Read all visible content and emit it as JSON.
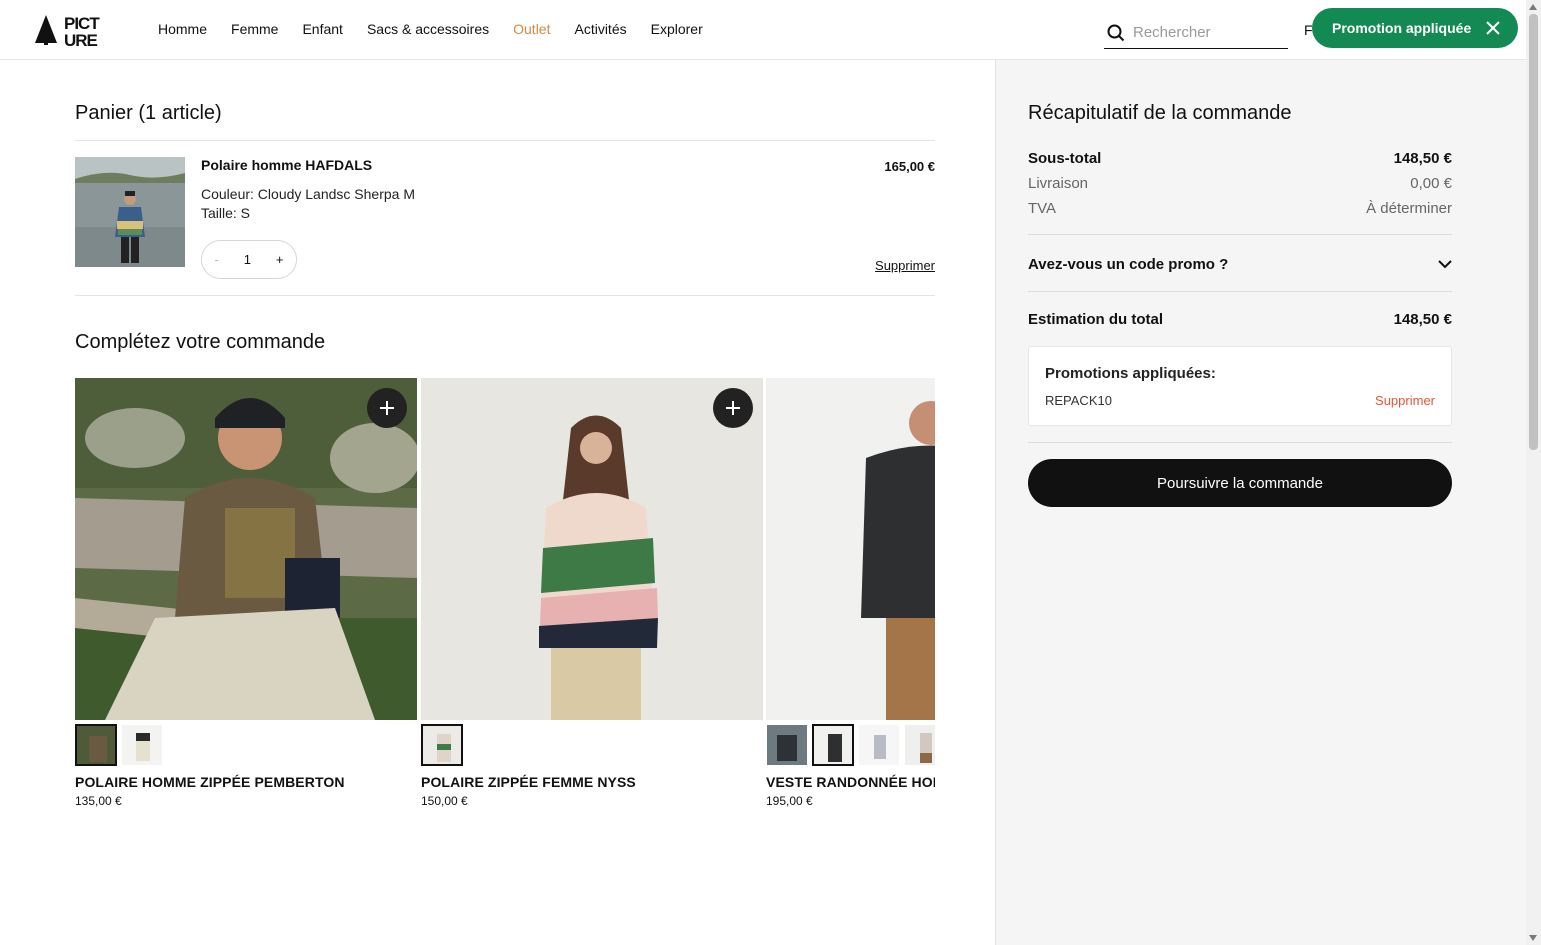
{
  "header": {
    "brand": "PICTURE",
    "nav": [
      "Homme",
      "Femme",
      "Enfant",
      "Sacs & accessoires",
      "Outlet",
      "Activités",
      "Explorer"
    ],
    "search_placeholder": "Rechercher",
    "lang_fragment": "F",
    "promo_toast": "Promotion appliquée"
  },
  "cart": {
    "title": "Panier (1 article)",
    "item": {
      "name": "Polaire homme HAFDALS",
      "price": "165,00 €",
      "color": "Couleur: Cloudy Landsc Sherpa M",
      "size": "Taille: S",
      "qty_minus": "-",
      "qty": "1",
      "qty_plus": "+",
      "remove": "Supprimer"
    }
  },
  "reco": {
    "title": "Complétez votre commande",
    "products": [
      {
        "name": "POLAIRE HOMME ZIPPÉE PEMBERTON",
        "price": "135,00 €"
      },
      {
        "name": "POLAIRE ZIPPÉE FEMME NYSS",
        "price": "150,00 €"
      },
      {
        "name": "VESTE RANDONNÉE HOMME",
        "price": "195,00 €"
      }
    ]
  },
  "summary": {
    "title": "Récapitulatif de la commande",
    "subtotal_label": "Sous-total",
    "subtotal_value": "148,50 €",
    "shipping_label": "Livraison",
    "shipping_value": "0,00 €",
    "tax_label": "TVA",
    "tax_value": "À déterminer",
    "promo_question": "Avez-vous un code promo ?",
    "total_label": "Estimation du total",
    "total_value": "148,50 €",
    "promos_applied_title": "Promotions appliquées:",
    "promo_code": "REPACK10",
    "promo_remove": "Supprimer",
    "checkout_button": "Poursuivre la commande"
  },
  "colors": {
    "accent_outlet": "#d58a44",
    "promo_green": "#138a53",
    "remove_red": "#e2563a"
  }
}
